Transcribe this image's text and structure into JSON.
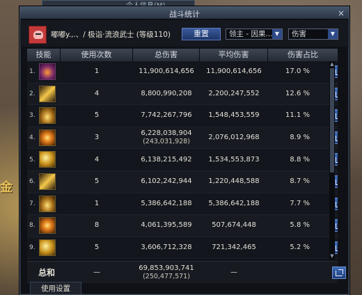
{
  "background": {
    "other_window_title": "个人信息(M)",
    "side_text": "金"
  },
  "window": {
    "title": "战斗统计",
    "close": "×"
  },
  "header": {
    "player_name": "嘟嘟y.,.、/ 极诣·流浪武士 (等级110)",
    "reset_label": "重置",
    "target_select": "领主 - 因果...",
    "metric_select": "伤害"
  },
  "table": {
    "columns": [
      "技能",
      "使用次数",
      "总伤害",
      "平均伤害",
      "伤害占比"
    ],
    "rows": [
      {
        "rank": "1.",
        "icon": "purple",
        "count": "1",
        "total": "11,900,614,656",
        "total_sub": "",
        "avg": "11,900,614,656",
        "pct": "17.0 %"
      },
      {
        "rank": "2.",
        "icon": "slash",
        "count": "4",
        "total": "8,800,990,208",
        "total_sub": "",
        "avg": "2,200,247,552",
        "pct": "12.6 %"
      },
      {
        "rank": "3.",
        "icon": "gold3",
        "count": "5",
        "total": "7,742,267,796",
        "total_sub": "",
        "avg": "1,548,453,559",
        "pct": "11.1 %"
      },
      {
        "rank": "4.",
        "icon": "fire",
        "count": "3",
        "total": "6,228,038,904",
        "total_sub": "(243,031,928)",
        "avg": "2,076,012,968",
        "pct": "8.9 %"
      },
      {
        "rank": "5.",
        "icon": "gold2",
        "count": "4",
        "total": "6,138,215,492",
        "total_sub": "",
        "avg": "1,534,553,873",
        "pct": "8.8 %"
      },
      {
        "rank": "6.",
        "icon": "slash",
        "count": "5",
        "total": "6,102,242,944",
        "total_sub": "",
        "avg": "1,220,448,588",
        "pct": "8.7 %"
      },
      {
        "rank": "7.",
        "icon": "gold3",
        "count": "1",
        "total": "5,386,642,188",
        "total_sub": "",
        "avg": "5,386,642,188",
        "pct": "7.7 %"
      },
      {
        "rank": "8.",
        "icon": "fire",
        "count": "8",
        "total": "4,061,395,589",
        "total_sub": "",
        "avg": "507,674,448",
        "pct": "5.8 %"
      },
      {
        "rank": "9.",
        "icon": "gold2",
        "count": "5",
        "total": "3,606,712,328",
        "total_sub": "",
        "avg": "721,342,465",
        "pct": "5.2 %"
      }
    ],
    "total": {
      "label": "总和",
      "count": "—",
      "total": "69,853,903,741",
      "total_sub": "(250,477,571)",
      "avg": "—"
    }
  },
  "bottom": {
    "tab_label": "使用设置"
  },
  "scrollbar": {
    "up": "▲",
    "down": "▼"
  }
}
